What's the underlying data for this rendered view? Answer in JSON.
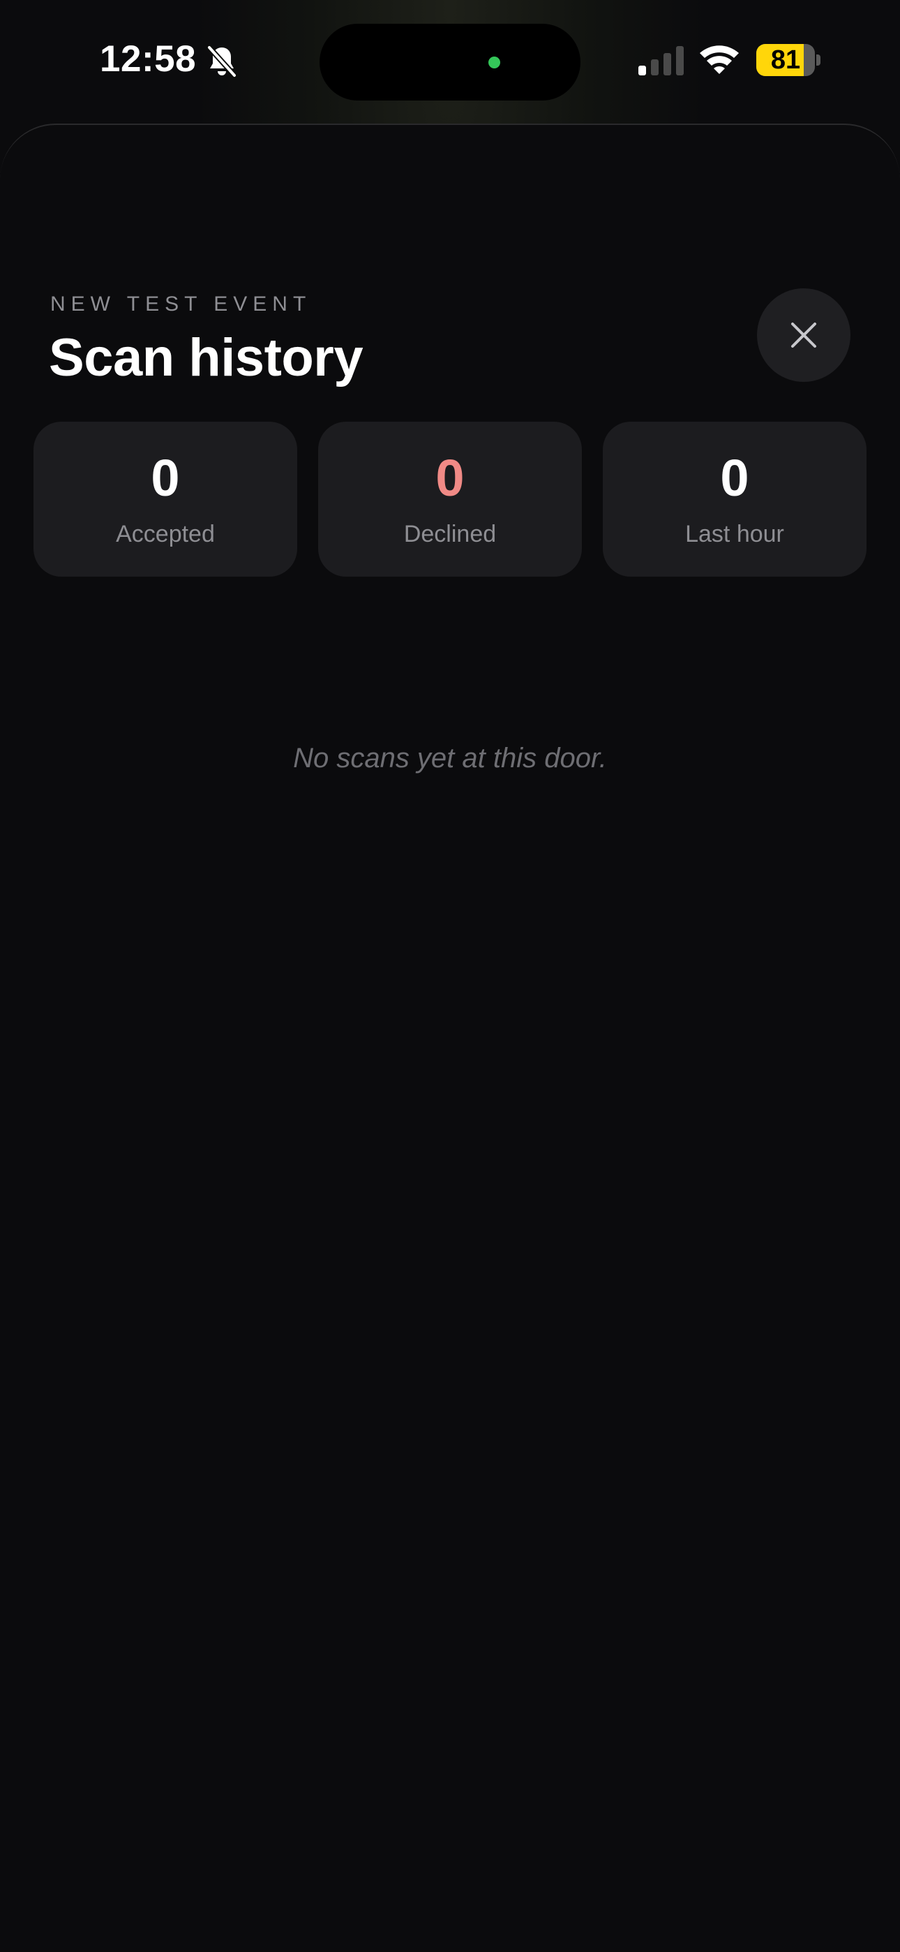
{
  "status_bar": {
    "time": "12:58",
    "battery_level": "81",
    "battery_fraction": 0.81,
    "icons": [
      "bell-slash-icon",
      "cellular-signal-icon",
      "wifi-icon",
      "battery-icon"
    ]
  },
  "sheet": {
    "event_name": "NEW TEST EVENT",
    "title": "Scan history",
    "close_icon": "close-icon",
    "stats": [
      {
        "value": "0",
        "label": "Accepted"
      },
      {
        "value": "0",
        "label": "Declined"
      },
      {
        "value": "0",
        "label": "Last hour"
      }
    ],
    "empty_message": "No scans yet at this door."
  },
  "colors": {
    "background": "#0b0b0d",
    "card": "#1c1c1f",
    "declined": "#f08a86",
    "battery": "#ffd60a",
    "island_indicator": "#34c759"
  }
}
